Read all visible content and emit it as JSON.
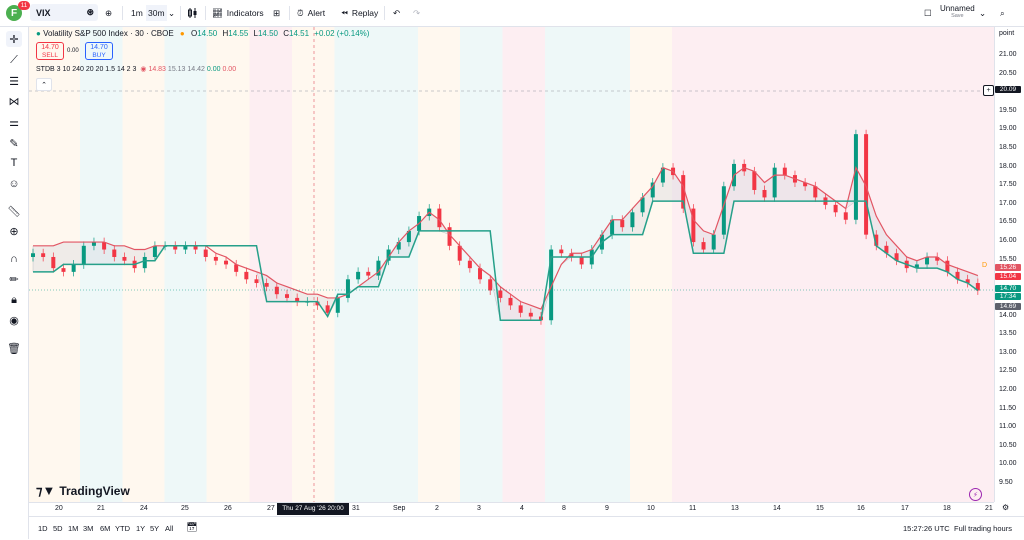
{
  "topbar": {
    "avatar_letter": "F",
    "notification_count": "11",
    "symbol": "VIX",
    "interval_1": "1m",
    "interval_2": "30m",
    "indicators_label": "Indicators",
    "alert_label": "Alert",
    "replay_label": "Replay",
    "layout_name": "Unnamed",
    "layout_status": "Save"
  },
  "legend": {
    "title": "Volatility S&P 500 Index · 30 · CBOE",
    "open_label": "O",
    "open": "14.50",
    "high_label": "H",
    "high": "14.55",
    "low_label": "L",
    "low": "14.50",
    "close_label": "C",
    "close": "14.51",
    "change": "+0.02 (+0.14%)"
  },
  "trade": {
    "sell_price": "14.70",
    "sell_label": "SELL",
    "spread": "0.00",
    "buy_price": "14.70",
    "buy_label": "BUY"
  },
  "indicator": {
    "name": "STDB",
    "params": "3 10 240 20 20 1.5 14 2 3",
    "v1": "14.83",
    "v2": "15.13",
    "v3": "14.42",
    "v4": "0.00",
    "v5": "0.00"
  },
  "price_axis": {
    "header": "point",
    "ticks": [
      "21.00",
      "20.50",
      "20.00",
      "19.50",
      "19.00",
      "18.50",
      "18.00",
      "17.50",
      "17.00",
      "16.50",
      "16.00",
      "15.50",
      "15.00",
      "14.50",
      "14.00",
      "13.50",
      "13.00",
      "12.50",
      "12.00",
      "11.50",
      "11.00",
      "10.50",
      "10.00",
      "9.50"
    ],
    "crosshair_price": "20.09",
    "label_upper": "15.26",
    "label_mid": "15.04",
    "label_last": "14.70",
    "label_countdown": "17:34",
    "label_low": "14.69"
  },
  "time_axis": {
    "ticks": [
      "20",
      "21",
      "24",
      "25",
      "26",
      "27",
      "30",
      "31",
      "Sep",
      "2",
      "3",
      "4",
      "8",
      "9",
      "10",
      "11",
      "13",
      "14",
      "15",
      "16",
      "17",
      "18",
      "21"
    ],
    "crosshair_time": "Thu 27 Aug '26   20:00"
  },
  "bottom": {
    "ranges": [
      "1D",
      "5D",
      "1M",
      "3M",
      "6M",
      "YTD",
      "1Y",
      "5Y",
      "All"
    ],
    "clock": "15:27:26 UTC",
    "session": "Full trading hours"
  },
  "watermark": "TradingView",
  "colors": {
    "up": "#089981",
    "down": "#f23645",
    "upper_band": "#e25563",
    "lower_band": "#26a08a",
    "accent": "#2962ff"
  },
  "chart_data": {
    "type": "candlestick",
    "ylim": [
      9.5,
      21.0
    ],
    "close_series": [
      15.7,
      15.6,
      15.3,
      15.2,
      15.4,
      15.9,
      16.0,
      15.8,
      15.6,
      15.5,
      15.3,
      15.6,
      15.9,
      15.9,
      15.8,
      15.9,
      15.8,
      15.6,
      15.5,
      15.4,
      15.2,
      15.0,
      14.9,
      14.8,
      14.6,
      14.5,
      14.4,
      14.4,
      14.3,
      14.1,
      14.5,
      15.0,
      15.2,
      15.1,
      15.5,
      15.8,
      16.0,
      16.3,
      16.7,
      16.9,
      16.4,
      15.9,
      15.5,
      15.3,
      15.0,
      14.7,
      14.5,
      14.3,
      14.1,
      14.0,
      13.9,
      15.8,
      15.7,
      15.6,
      15.4,
      15.8,
      16.2,
      16.6,
      16.4,
      16.8,
      17.2,
      17.6,
      18.0,
      17.8,
      16.9,
      16.0,
      15.8,
      16.2,
      17.5,
      18.1,
      17.9,
      17.4,
      17.2,
      18.0,
      17.8,
      17.6,
      17.5,
      17.2,
      17.0,
      16.8,
      16.6,
      18.9,
      16.2,
      15.9,
      15.7,
      15.5,
      15.3,
      15.4,
      15.6,
      15.5,
      15.2,
      15.0,
      14.9,
      14.7
    ],
    "upper_band": [
      15.9,
      15.9,
      15.9,
      16.0,
      16.0,
      16.0,
      16.0,
      16.0,
      15.9,
      15.9,
      15.8,
      15.8,
      15.9,
      15.9,
      15.9,
      15.9,
      15.9,
      15.9,
      15.7,
      15.6,
      15.4,
      15.3,
      15.2,
      15.1,
      14.9,
      14.8,
      14.7,
      14.6,
      14.6,
      14.5,
      14.5,
      14.6,
      14.8,
      15.0,
      15.2,
      15.6,
      16.0,
      16.3,
      16.5,
      16.8,
      16.6,
      16.2,
      15.9,
      15.6,
      15.3,
      15.1,
      14.8,
      14.6,
      14.4,
      14.3,
      14.2,
      14.8,
      15.4,
      15.7,
      15.7,
      15.8,
      16.2,
      16.6,
      16.6,
      16.9,
      17.2,
      17.5,
      18.0,
      17.9,
      17.5,
      16.6,
      16.3,
      16.2,
      17.0,
      17.8,
      18.0,
      17.9,
      17.6,
      17.8,
      17.8,
      17.7,
      17.6,
      17.5,
      17.3,
      17.1,
      16.9,
      18.0,
      17.5,
      16.7,
      16.2,
      15.9,
      15.6,
      15.5,
      15.6,
      15.6,
      15.4,
      15.3,
      15.2,
      15.1
    ],
    "lower_band": [
      15.2,
      15.2,
      15.2,
      15.4,
      15.4,
      15.4,
      15.4,
      15.4,
      15.4,
      15.4,
      15.4,
      15.5,
      15.5,
      15.9,
      15.9,
      15.9,
      15.9,
      15.9,
      15.9,
      15.9,
      15.9,
      15.9,
      15.9,
      14.4,
      14.4,
      14.4,
      14.4,
      14.4,
      14.4,
      14.0,
      14.6,
      14.6,
      14.8,
      14.8,
      14.8,
      15.6,
      15.6,
      15.6,
      16.3,
      16.3,
      16.3,
      16.3,
      16.3,
      16.3,
      16.3,
      16.3,
      13.9,
      13.9,
      13.9,
      13.9,
      13.9,
      15.6,
      15.6,
      15.6,
      15.6,
      15.6,
      16.0,
      16.2,
      16.2,
      16.2,
      16.2,
      17.1,
      17.1,
      17.1,
      17.1,
      15.7,
      15.7,
      15.7,
      15.7,
      17.1,
      17.1,
      17.1,
      17.1,
      17.1,
      17.1,
      17.1,
      17.1,
      17.1,
      17.1,
      17.1,
      17.1,
      17.1,
      17.1,
      15.9,
      15.7,
      15.5,
      15.4,
      15.3,
      15.3,
      15.3,
      15.2,
      15.0,
      14.9,
      14.7
    ]
  }
}
